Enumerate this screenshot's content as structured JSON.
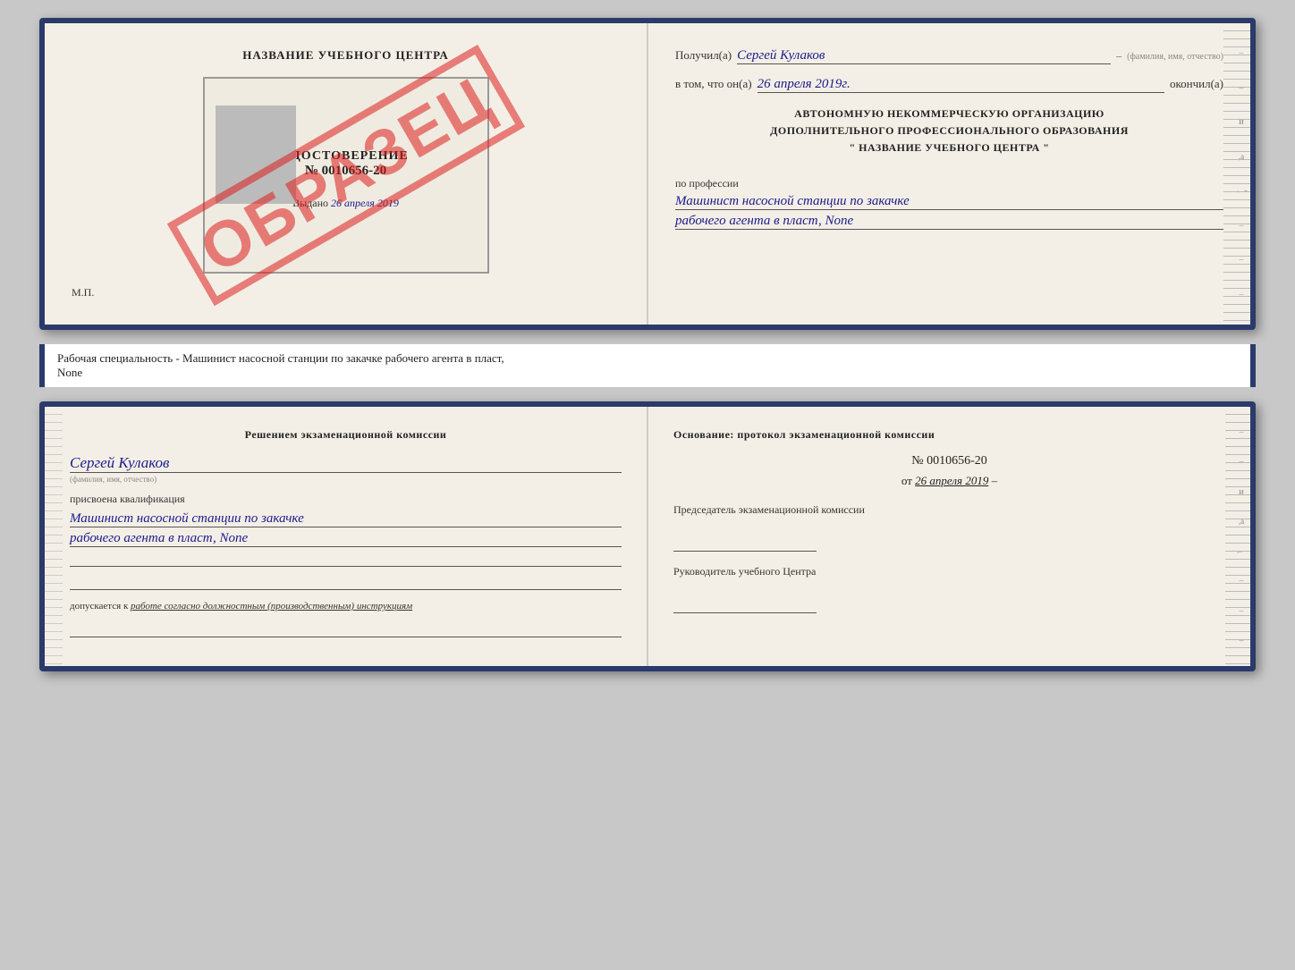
{
  "top": {
    "left": {
      "center_title": "НАЗВАНИЕ УЧЕБНОГО ЦЕНТРА",
      "cert_title": "УДОСТОВЕРЕНИЕ",
      "cert_number": "№ 0010656-20",
      "issued_label": "Выдано",
      "issued_date": "26 апреля 2019",
      "mp_label": "М.П.",
      "obrazec": "ОБРАЗЕЦ"
    },
    "right": {
      "received_label": "Получил(а)",
      "received_name": "Сергей Кулаков",
      "name_hint": "(фамилия, имя, отчество)",
      "in_that_label": "в том, что он(а)",
      "in_that_date": "26 апреля 2019г.",
      "finished_label": "окончил(а)",
      "org_line1": "АВТОНОМНУЮ НЕКОММЕРЧЕСКУЮ ОРГАНИЗАЦИЮ",
      "org_line2": "ДОПОЛНИТЕЛЬНОГО ПРОФЕССИОНАЛЬНОГО ОБРАЗОВАНИЯ",
      "org_line3": "\"  НАЗВАНИЕ УЧЕБНОГО ЦЕНТРА  \"",
      "profession_label": "по профессии",
      "profession_line1": "Машинист насосной станции по закачке",
      "profession_line2": "рабочего агента в пласт, None"
    }
  },
  "separator": {
    "text": "Рабочая специальность - Машинист насосной станции по закачке рабочего агента в пласт,",
    "text2": "None"
  },
  "bottom": {
    "left": {
      "heading": "Решением экзаменационной комиссии",
      "name": "Сергей Кулаков",
      "name_hint": "(фамилия, имя, отчество)",
      "qual_label": "присвоена квалификация",
      "qual_line1": "Машинист насосной станции по закачке",
      "qual_line2": "рабочего агента в пласт, None",
      "допускается_prefix": "допускается к",
      "допускается_value": "работе согласно должностным (производственным) инструкциям"
    },
    "right": {
      "basis_label": "Основание: протокол экзаменационной комиссии",
      "protocol_number": "№ 0010656-20",
      "protocol_date_prefix": "от",
      "protocol_date": "26 апреля 2019",
      "chairman_label": "Председатель экзаменационной комиссии",
      "director_label": "Руководитель учебного Центра"
    }
  }
}
